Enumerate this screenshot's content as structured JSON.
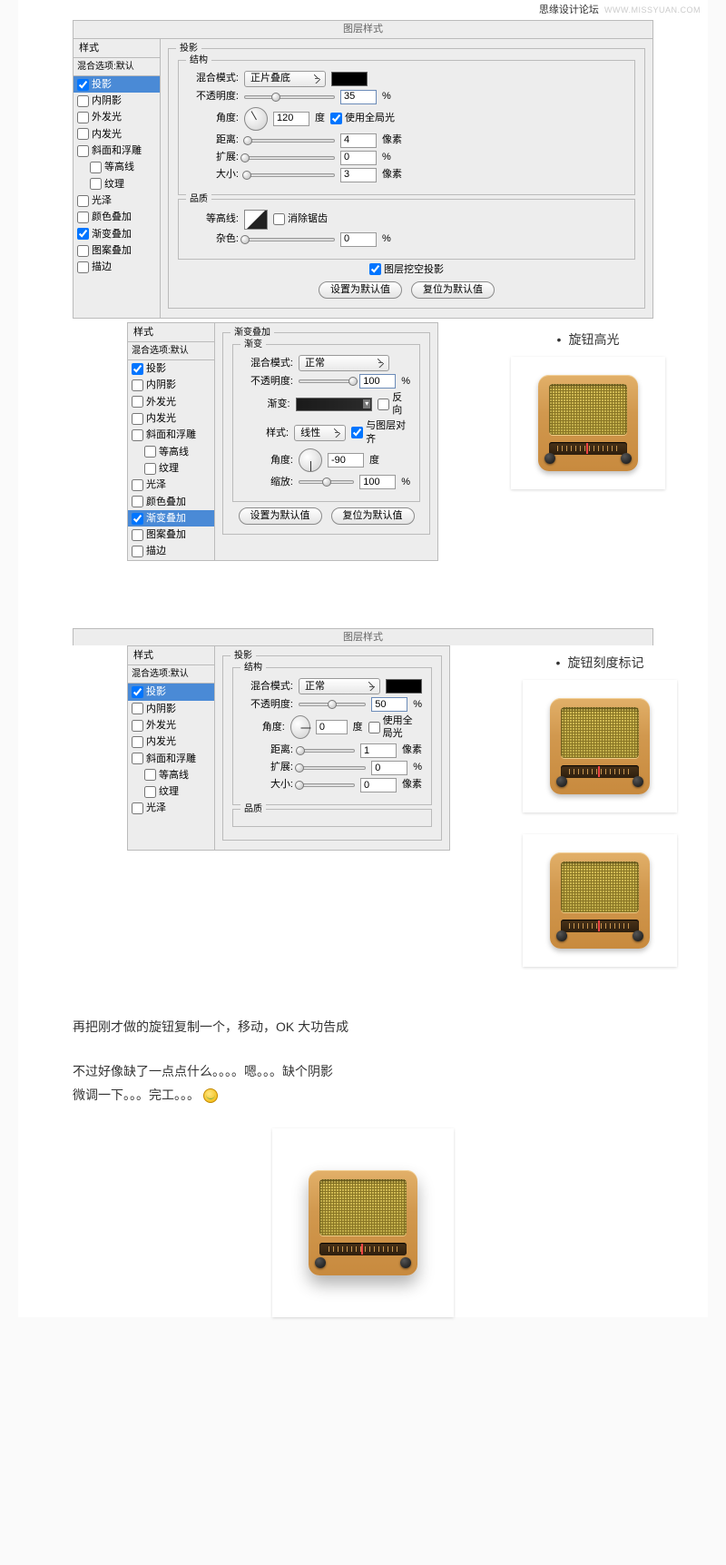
{
  "watermark": {
    "name": "思缘设计论坛",
    "url": "WWW.MISSYUAN.COM"
  },
  "titles": {
    "dialog": "图层样式",
    "styles": "样式",
    "blend": "混合选项:默认"
  },
  "styles_list": [
    {
      "k": "shadow",
      "t": "投影"
    },
    {
      "k": "inner_shadow",
      "t": "内阴影"
    },
    {
      "k": "outer_glow",
      "t": "外发光"
    },
    {
      "k": "inner_glow",
      "t": "内发光"
    },
    {
      "k": "bevel",
      "t": "斜面和浮雕"
    },
    {
      "k": "contour",
      "t": "等高线",
      "sub": true
    },
    {
      "k": "texture",
      "t": "纹理",
      "sub": true
    },
    {
      "k": "satin",
      "t": "光泽"
    },
    {
      "k": "color_overlay",
      "t": "颜色叠加"
    },
    {
      "k": "grad_overlay",
      "t": "渐变叠加"
    },
    {
      "k": "pattern",
      "t": "图案叠加"
    },
    {
      "k": "stroke",
      "t": "描边"
    }
  ],
  "labels": {
    "drop_shadow": "投影",
    "struct": "结构",
    "quality": "品质",
    "grad_overlay": "渐变叠加",
    "gradient": "渐变",
    "blend_mode": "混合模式:",
    "opacity": "不透明度:",
    "angle": "角度:",
    "deg": "度",
    "use_global": "使用全局光",
    "distance": "距离:",
    "spread": "扩展:",
    "size": "大小:",
    "px": "像素",
    "pct": "%",
    "contour": "等高线:",
    "anti_alias": "消除锯齿",
    "noise": "杂色:",
    "knock": "图层挖空投影",
    "make_default": "设置为默认值",
    "reset_default": "复位为默认值",
    "gradient_lbl": "渐变:",
    "reverse": "反向",
    "style": "样式:",
    "align_layer": "与图层对齐",
    "scale": "缩放:"
  },
  "panel1": {
    "checked": {
      "shadow": true,
      "grad_overlay": true
    },
    "sel": "shadow",
    "blend_mode": "正片叠底",
    "opacity": 35,
    "angle": 120,
    "use_global": true,
    "distance": 4,
    "spread": 0,
    "size": 3,
    "noise": 0,
    "knock": true
  },
  "panel2": {
    "checked": {
      "shadow": true,
      "grad_overlay": true
    },
    "sel": "grad_overlay",
    "blend_mode": "正常",
    "opacity": 100,
    "reverse": false,
    "style": "线性",
    "align": true,
    "angle": -90,
    "scale": 100
  },
  "panel3": {
    "checked": {
      "shadow": true
    },
    "sel": "shadow",
    "blend_mode": "正常",
    "opacity": 50,
    "angle": 0,
    "use_global": false,
    "distance": 1,
    "spread": 0,
    "size": 0
  },
  "side": {
    "knob_highlight": "旋钮高光",
    "knob_scale": "旋钮刻度标记"
  },
  "text1": "再把刚才做的旋钮复制一个，移动，OK  大功告成",
  "text2a": "不过好像缺了一点点什么。。。。嗯。。。缺个阴影",
  "text2b": "微调一下。。。完工。。。"
}
